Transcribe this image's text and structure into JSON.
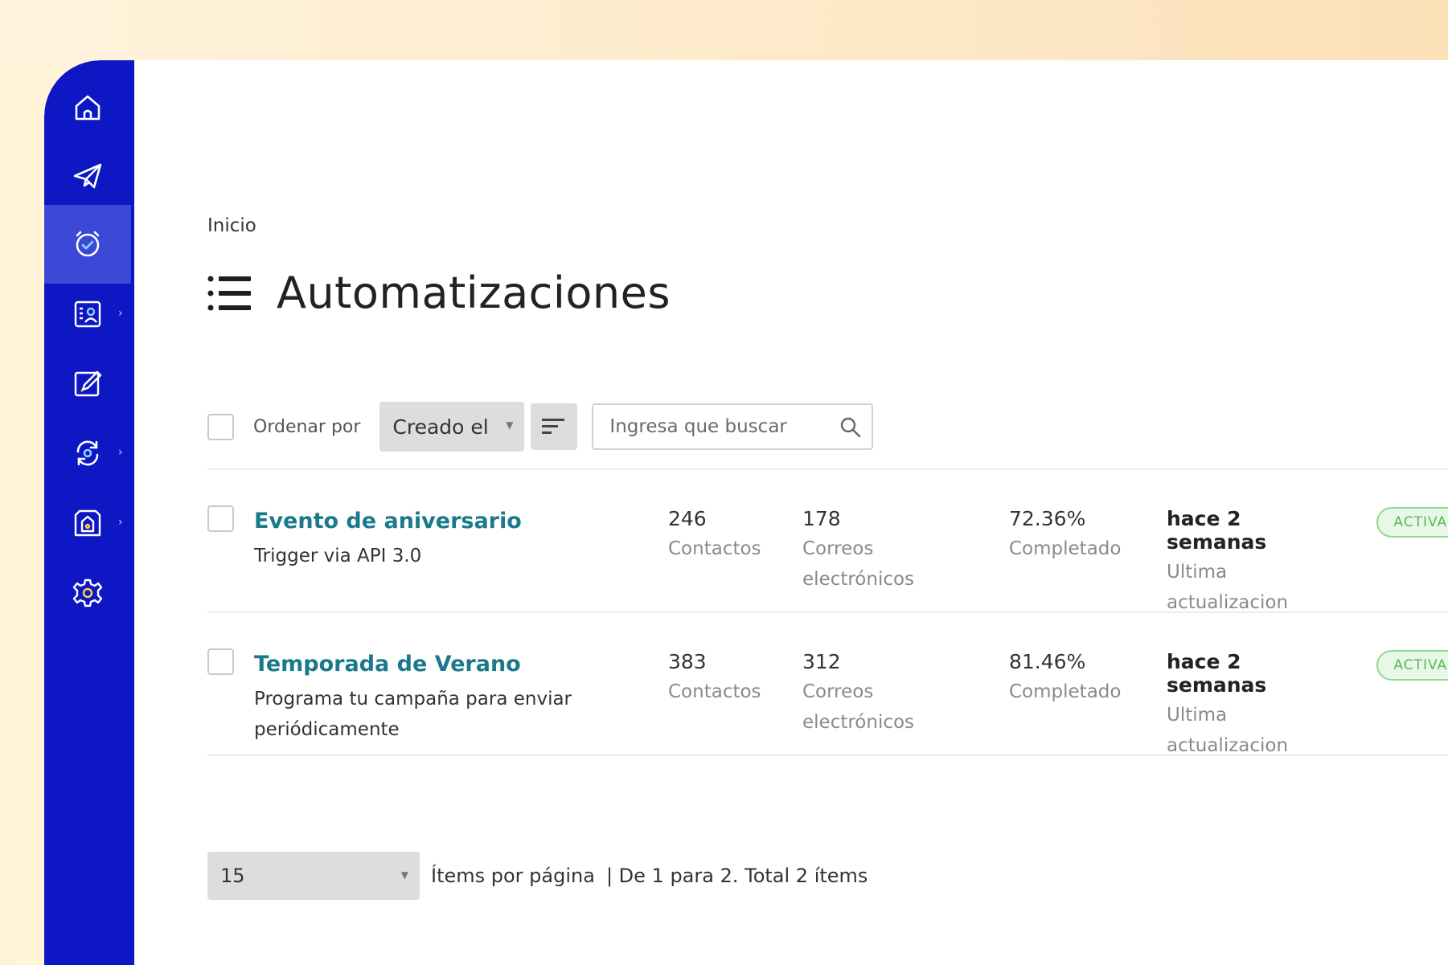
{
  "breadcrumb": "Inicio",
  "page_title": "Automatizaciones",
  "toolbar": {
    "sort_label": "Ordenar por",
    "sort_value": "Creado el",
    "search_placeholder": "Ingresa que buscar"
  },
  "sidebar": {
    "items": [
      {
        "icon": "home-icon"
      },
      {
        "icon": "paper-plane-icon"
      },
      {
        "icon": "alarm-clock-icon",
        "active": true
      },
      {
        "icon": "contacts-icon",
        "has_submenu": true
      },
      {
        "icon": "edit-icon"
      },
      {
        "icon": "sync-icon",
        "has_submenu": true
      },
      {
        "icon": "template-icon",
        "has_submenu": true
      },
      {
        "icon": "gear-icon"
      }
    ]
  },
  "rows": [
    {
      "name": "Evento de aniversario",
      "description": "Trigger via API 3.0",
      "contacts": "246",
      "contacts_label": "Contactos",
      "emails": "178",
      "emails_label": "Correos electrónicos",
      "completed": "72.36%",
      "completed_label": "Completado",
      "updated": "hace 2 semanas",
      "updated_label": "Ultima actualizacion",
      "status": "ACTIVADA"
    },
    {
      "name": "Temporada de Verano",
      "description": "Programa tu campaña para enviar periódicamente",
      "contacts": "383",
      "contacts_label": "Contactos",
      "emails": "312",
      "emails_label": "Correos electrónicos",
      "completed": "81.46%",
      "completed_label": "Completado",
      "updated": "hace 2 semanas",
      "updated_label": "Ultima actualizacion",
      "status": "ACTIVADA"
    }
  ],
  "pager": {
    "per_page": "15",
    "per_page_label": "Ítems por página",
    "summary": "| De 1 para 2. Total 2 ítems"
  },
  "colors": {
    "sidebar": "#0e17c4",
    "sidebar_active": "#3c48d6",
    "link": "#1b7a8a",
    "badge_green": "#56b956"
  }
}
